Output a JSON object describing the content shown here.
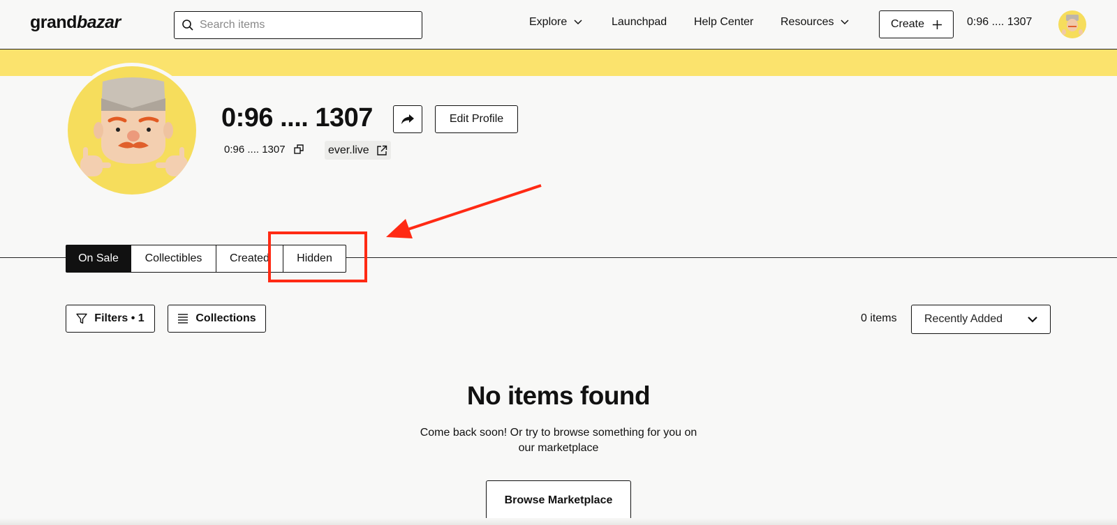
{
  "header": {
    "logo": {
      "part1": "grand",
      "part2": "bazar"
    },
    "search": {
      "placeholder": "Search items"
    },
    "nav": [
      {
        "label": "Explore",
        "has_dropdown": true
      },
      {
        "label": "Launchpad",
        "has_dropdown": false
      },
      {
        "label": "Help Center",
        "has_dropdown": false
      },
      {
        "label": "Resources",
        "has_dropdown": true
      }
    ],
    "create_label": "Create",
    "wallet": "0:96 .... 1307"
  },
  "colors": {
    "banner": "#fbe36d",
    "avatar_bg": "#f6dd5c",
    "annotation": "#ff2a14",
    "active_tab": "#111111"
  },
  "profile": {
    "name": "0:96 .... 1307",
    "edit_label": "Edit Profile",
    "address": "0:96 .... 1307",
    "site": "ever.live"
  },
  "tabs": [
    {
      "label": "On Sale",
      "active": true
    },
    {
      "label": "Collectibles",
      "active": false
    },
    {
      "label": "Created",
      "active": false
    },
    {
      "label": "Hidden",
      "active": false
    }
  ],
  "toolbar": {
    "filters_label": "Filters • 1",
    "collections_label": "Collections",
    "count": "0 items",
    "sort_value": "Recently Added"
  },
  "empty": {
    "title": "No items found",
    "text": "Come back soon! Or try to browse something for you on our marketplace",
    "button": "Browse Marketplace"
  }
}
